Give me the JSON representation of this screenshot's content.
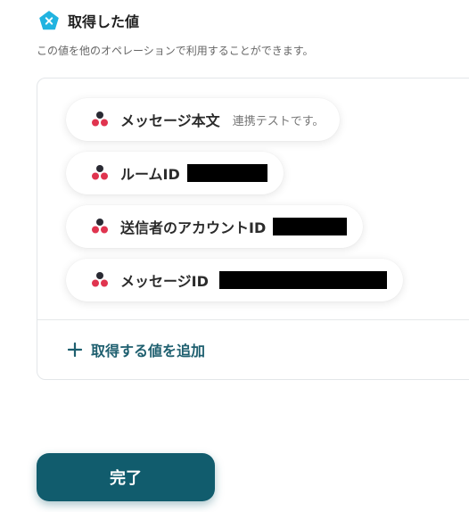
{
  "header": {
    "title": "取得した値",
    "icon": "pentagon-x-icon",
    "icon_color": "#20b3e0"
  },
  "description": "この値を他のオペレーションで利用することができます。",
  "values": [
    {
      "label": "メッセージ本文",
      "value": "連携テストです。",
      "redacted": false,
      "icon": "chatwork-logo-icon"
    },
    {
      "label": "ルームID",
      "value": "",
      "redacted": true,
      "icon": "chatwork-logo-icon"
    },
    {
      "label": "送信者のアカウントID",
      "value": "",
      "redacted": true,
      "icon": "chatwork-logo-icon"
    },
    {
      "label": "メッセージID",
      "value": "",
      "redacted": true,
      "icon": "chatwork-logo-icon"
    }
  ],
  "add_value_label": "取得する値を追加",
  "done_label": "完了",
  "colors": {
    "primary": "#115c6d",
    "accent": "#1e5f6f",
    "logo_red": "#e0344f",
    "logo_dark": "#2a2a33"
  }
}
